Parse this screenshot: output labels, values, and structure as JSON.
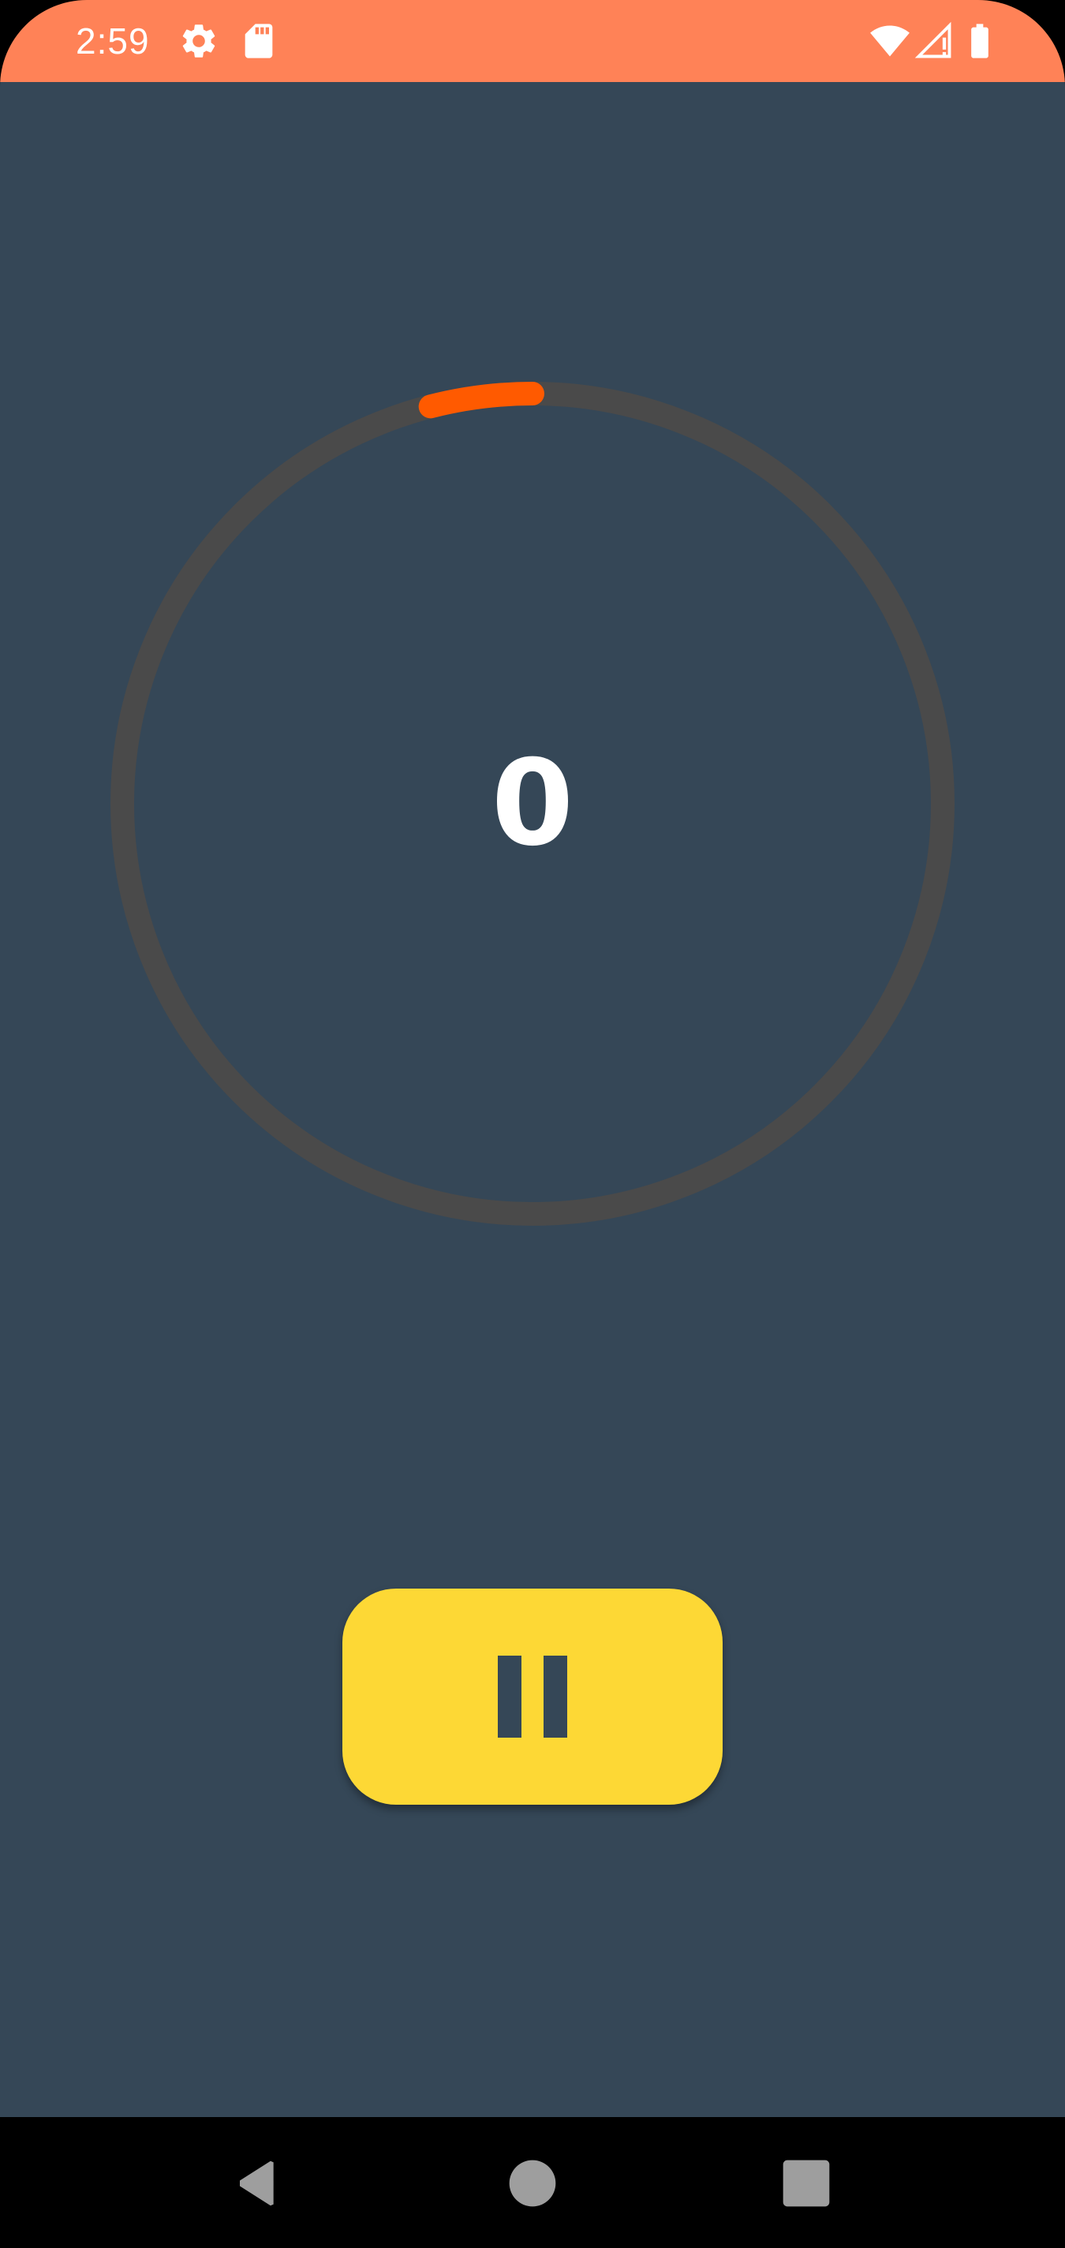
{
  "status_bar": {
    "time": "2:59",
    "background_color": "#ff8257",
    "left_icons": [
      "gear-icon",
      "sd-card-icon"
    ],
    "right_icons": [
      "wifi-icon",
      "cellular-no-signal-icon",
      "battery-icon"
    ]
  },
  "timer": {
    "count": "0",
    "progress_fraction": 0.04,
    "track_color": "#4a4a4a",
    "progress_color": "#ff5a00"
  },
  "controls": {
    "pause_button_icon": "pause-icon",
    "button_color": "#fdd835"
  },
  "theme": {
    "app_background": "#354757"
  },
  "nav_bar": {
    "buttons": [
      "back-icon",
      "home-icon",
      "recents-icon"
    ]
  }
}
